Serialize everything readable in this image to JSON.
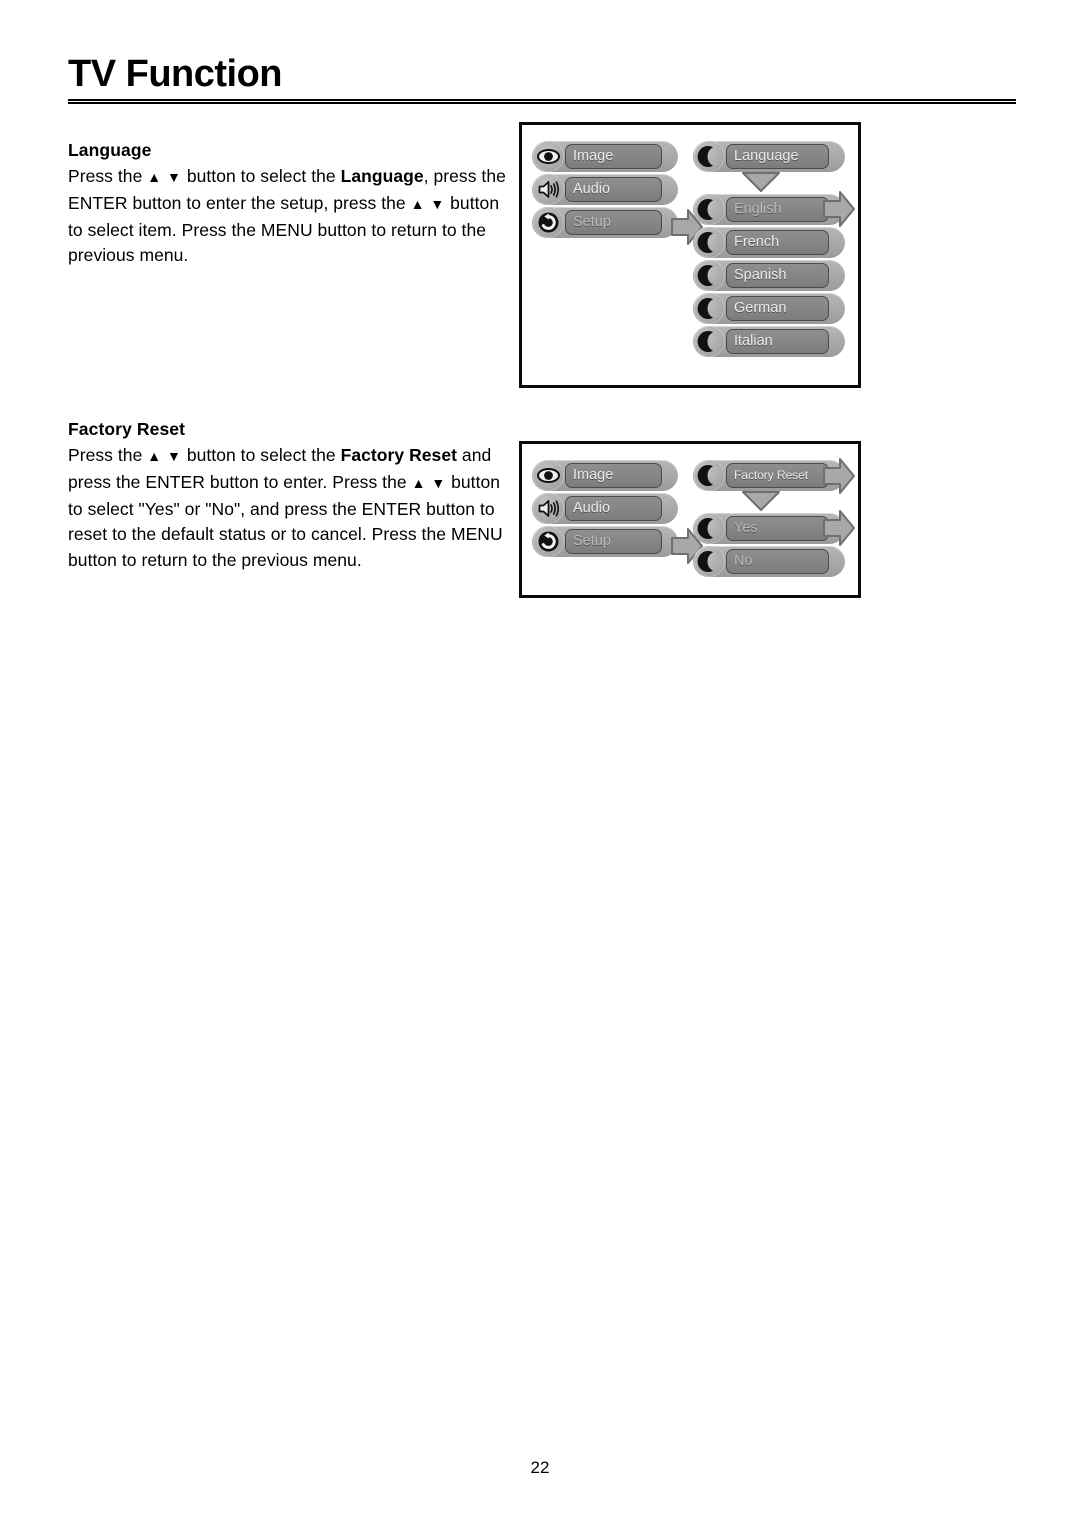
{
  "page": {
    "title": "TV Function",
    "number": "22"
  },
  "sections": [
    {
      "heading": "Language",
      "body_parts": [
        {
          "text": "Press the ",
          "bold": false
        },
        {
          "text": "▲ ▼",
          "bold": false,
          "arrows": true
        },
        {
          "text": " button to select the ",
          "bold": false
        },
        {
          "text": "Language",
          "bold": true
        },
        {
          "text": ", press the ENTER button to enter the setup, press the ",
          "bold": false
        },
        {
          "text": "▲ ▼",
          "bold": false,
          "arrows": true
        },
        {
          "text": " button to select item. Press the MENU button to return to the previous menu.",
          "bold": false
        }
      ]
    },
    {
      "heading": "Factory Reset",
      "body_parts": [
        {
          "text": "Press the ",
          "bold": false
        },
        {
          "text": "▲ ▼",
          "bold": false,
          "arrows": true
        },
        {
          "text": " button to select the ",
          "bold": false
        },
        {
          "text": "Factory Reset",
          "bold": true
        },
        {
          "text": " and press the ENTER button to enter. Press the ",
          "bold": false
        },
        {
          "text": "▲ ▼",
          "bold": false,
          "arrows": true
        },
        {
          "text": " button to select \"Yes\" or \"No\",  and press the ENTER button to reset to the default status or to cancel. Press the MENU button to return to the previous menu.",
          "bold": false
        }
      ]
    }
  ],
  "osd_language": {
    "main_menu": [
      {
        "label": "Image",
        "icon": "eye-icon",
        "dim": false
      },
      {
        "label": "Audio",
        "icon": "speaker-icon",
        "dim": false
      },
      {
        "label": "Setup",
        "icon": "reset-circle-icon",
        "dim": true
      }
    ],
    "submenu_title": {
      "label": "Language",
      "icon": "moon-icon",
      "dim": false
    },
    "submenu_items": [
      {
        "label": "English",
        "icon": "moon-icon",
        "dim": true
      },
      {
        "label": "French",
        "icon": "moon-icon",
        "dim": false
      },
      {
        "label": "Spanish",
        "icon": "moon-icon",
        "dim": false
      },
      {
        "label": "German",
        "icon": "moon-icon",
        "dim": false
      },
      {
        "label": "Italian",
        "icon": "moon-icon",
        "dim": false
      }
    ]
  },
  "osd_factory_reset": {
    "main_menu": [
      {
        "label": "Image",
        "icon": "eye-icon",
        "dim": false
      },
      {
        "label": "Audio",
        "icon": "speaker-icon",
        "dim": false
      },
      {
        "label": "Setup",
        "icon": "reset-circle-icon",
        "dim": true
      }
    ],
    "submenu_title": {
      "label": "Factory Reset",
      "icon": "moon-icon",
      "dim": false
    },
    "submenu_items": [
      {
        "label": "Yes",
        "icon": "moon-icon",
        "dim": true
      },
      {
        "label": "No",
        "icon": "moon-icon",
        "dim": true
      }
    ]
  },
  "colors": {
    "pill_outer": "#ababab",
    "pill_inner": "#868686",
    "pill_text": "#e9e9e9",
    "frame_border": "#0a0a0a",
    "arrow_fill": "#a8a8a8",
    "arrow_stroke": "#6f6f6f"
  }
}
